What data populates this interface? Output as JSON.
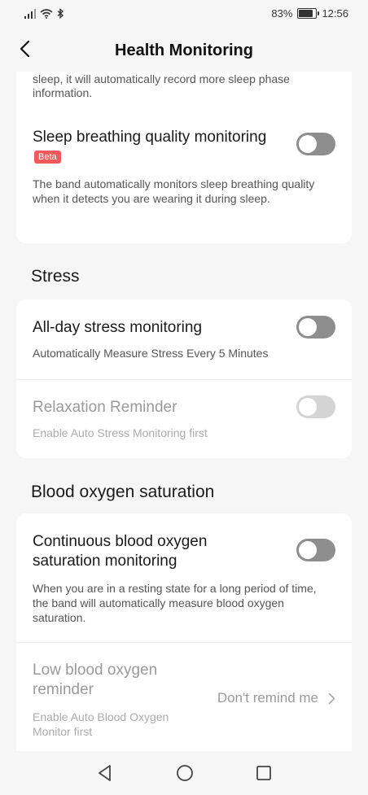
{
  "status": {
    "battery": "83%",
    "battery_level": 0.83,
    "time": "12:56"
  },
  "header": {
    "title": "Health Monitoring"
  },
  "top_card": {
    "partial_text": "sleep, it will automatically record more sleep phase information.",
    "sleep_breathing": {
      "title": "Sleep breathing quality monitoring",
      "badge": "Beta",
      "description": "The band automatically monitors sleep breathing quality when it detects you are wearing it during sleep.",
      "enabled": false
    }
  },
  "stress": {
    "section_title": "Stress",
    "all_day": {
      "title": "All-day stress monitoring",
      "description": "Automatically Measure Stress Every 5 Minutes",
      "enabled": false
    },
    "relaxation": {
      "title": "Relaxation Reminder",
      "description": "Enable Auto Stress Monitoring first",
      "enabled": false
    }
  },
  "blood_oxygen": {
    "section_title": "Blood oxygen saturation",
    "continuous": {
      "title": "Continuous blood oxygen saturation monitoring",
      "description": "When you are in a resting state for a long period of time, the band will automatically measure blood oxygen saturation.",
      "enabled": false
    },
    "low_reminder": {
      "title": "Low blood oxygen reminder",
      "description": "Enable Auto Blood Oxygen Monitor first",
      "value": "Don't remind me"
    }
  }
}
